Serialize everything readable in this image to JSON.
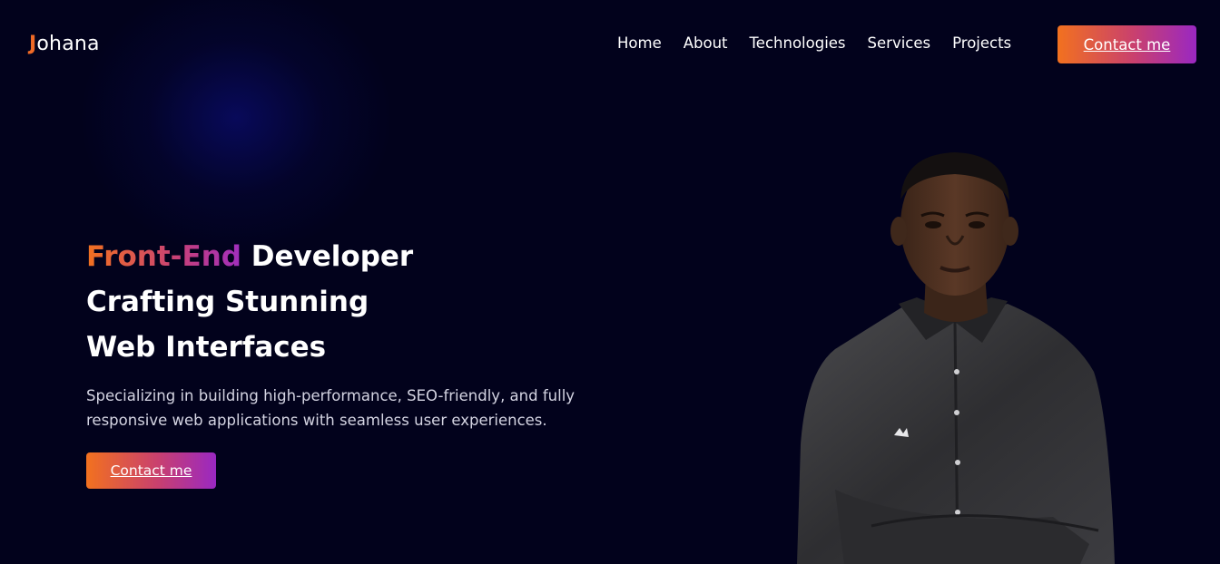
{
  "brand": {
    "logo_lead": "J",
    "logo_rest": "ohana",
    "accent": "#f06a26",
    "gradient_start": "#f2711f",
    "gradient_end": "#9a28c2",
    "background": "#02021c"
  },
  "nav": {
    "items": [
      {
        "label": "Home"
      },
      {
        "label": "About"
      },
      {
        "label": "Technologies"
      },
      {
        "label": "Services"
      },
      {
        "label": "Projects"
      }
    ],
    "cta_label": "Contact me"
  },
  "hero": {
    "title_highlight": "Front-End",
    "title_line1_rest": " Developer",
    "title_line2": "Crafting Stunning",
    "title_line3": "Web Interfaces",
    "description": "Specializing in building high-performance, SEO-friendly, and fully responsive web applications with seamless user experiences.",
    "cta_label": "Contact me",
    "portrait_icon": "person-portrait-icon"
  }
}
